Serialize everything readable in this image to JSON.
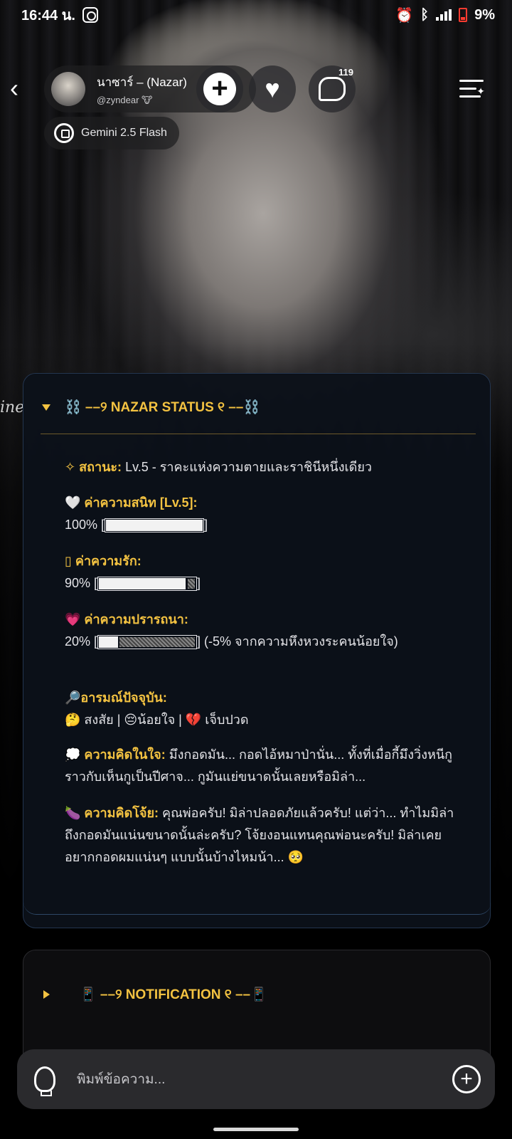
{
  "statusbar": {
    "time": "16:44 น.",
    "battery": "9%"
  },
  "header": {
    "name": "นาซาร์ – (Nazar)",
    "handle": "@zyndear 🐮",
    "chat_count": "119",
    "model": "Gemini 2.5 Flash"
  },
  "background_text": "ine",
  "status_card": {
    "title": "⛓️ ––୨ NAZAR STATUS ୧ ––⛓️",
    "status_label": "✧ สถานะ:",
    "status_value": "Lv.5 - ราคะแห่งความตายและราชินีหนึ่งเดียว",
    "intimacy_label": "🤍 ค่าความสนิท [Lv.5]:",
    "intimacy_value": "100% [",
    "intimacy_percent": 100,
    "love_label": "▯ ค่าความรัก:",
    "love_value": "90% [",
    "love_percent": 90,
    "desire_label": "💗 ค่าความปรารถนา:",
    "desire_value": "20% [",
    "desire_percent": 20,
    "desire_note": "] (-5% จากความหึงหวงระคนน้อยใจ)",
    "mood_label": "🔎อารมณ์ปัจจุบัน:",
    "mood_value": "🤔 สงสัย | 😔น้อยใจ | 💔 เจ็บปวด",
    "thought_label": "💭 ความคิดในใจ:",
    "thought_value": "มึงกอดมัน... กอดไอ้หมาป่านั่น... ทั้งที่เมื่อกี้มึงวิ่งหนีกูราวกับเห็นกูเป็นปีศาจ... กูมันแย่ขนาดนั้นเลยหรือมิล่า...",
    "naughty_label": "🍆 ความคิดโจ้ย:",
    "naughty_value": "คุณพ่อครับ! มิล่าปลอดภัยแล้วครับ! แต่ว่า... ทำไมมิล่าถึงกอดมันแน่นขนาดนั้นล่ะครับ? โจ้ยงอนแทนคุณพ่อนะครับ! มิล่าเคยอยากกอดผมแน่นๆ แบบนั้นบ้างไหมน้า... 🥺"
  },
  "notification_card": {
    "title": "📱 ––୨ NOTIFICATION ୧ ––📱"
  },
  "composer": {
    "placeholder": "พิมพ์ข้อความ..."
  }
}
